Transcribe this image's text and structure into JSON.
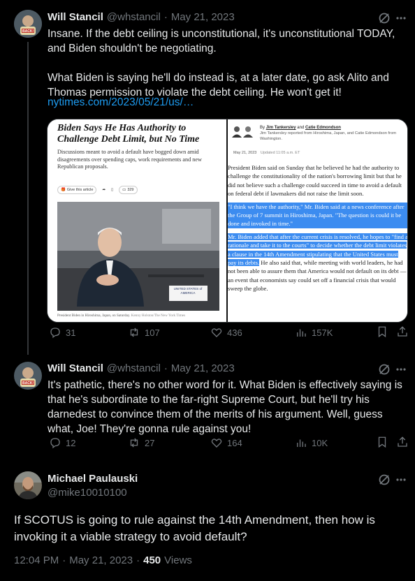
{
  "tweet1": {
    "name": "Will Stancil",
    "handle": "@whstancil",
    "dot": "·",
    "date": "May 21, 2023",
    "text": "Insane. If the debt ceiling is unconstitutional, it's unconstitutional TODAY, and Biden shouldn't be negotiating.\n\nWhat Biden is saying he'll do instead is, at a later date, go ask Alito and Thomas permission to violate the debt ceiling. He won't get it!",
    "link": "nytimes.com/2023/05/21/us/…",
    "media": {
      "headline": "Biden Says He Has Authority to Challenge Debt Limit, but No Time",
      "dek": "Discussions meant to avoid a default have bogged down amid disagreements over spending caps, work requirements and new Republican proposals.",
      "share_label": "Give this article",
      "comments_count": "329",
      "caption": "President Biden in Hiroshima, Japan, on Saturday.",
      "credit": "Kenny Holston/The New York Times",
      "placard": "UNITED STATES of AMERICA",
      "byline_prefix": "By",
      "author1": "Jim Tankersley",
      "byline_and": "and",
      "author2": "Catie Edmondson",
      "reported": "Jim Tankersley reported from Hiroshima, Japan, and Catie Edmondson from Washington.",
      "dateline": "May 21, 2023",
      "updated": "Updated 11:05 a.m. ET",
      "p1": "President Biden said on Sunday that he believed he had the authority to challenge the constitutionality of the nation's borrowing limit but that he did not believe such a challenge could succeed in time to avoid a default on federal debt if lawmakers did not raise the limit soon.",
      "p2": "\"I think we have the authority,\" Mr. Biden said at a news conference after the Group of 7 summit in Hiroshima, Japan. \"The question is could it be done and invoked in time.\"",
      "p3_hl": "Mr. Biden added that after the current crisis is resolved, he hopes to \"find a rationale and take it to the courts\" to decide whether the debt limit violates a clause in the 14th Amendment stipulating that the United States must pay its debts.",
      "p3_rest": " He also said that, while meeting with world leaders, he had not been able to assure them that America would not default on its debt — an event that economists say could set off a financial crisis that would sweep the globe."
    },
    "replies": "31",
    "reposts": "107",
    "likes": "436",
    "views": "157K"
  },
  "tweet2": {
    "name": "Will Stancil",
    "handle": "@whstancil",
    "dot": "·",
    "date": "May 21, 2023",
    "text": "It's pathetic, there's no other word for it. What Biden is effectively saying is that he's subordinate to the far-right Supreme Court, but he'll try his darnedest to convince them of the merits of his argument. Well, guess what, Joe! They're gonna rule against you!",
    "replies": "12",
    "reposts": "27",
    "likes": "164",
    "views": "10K"
  },
  "tweet3": {
    "name": "Michael Paulauski",
    "handle": "@mike10010100",
    "text": "If SCOTUS is going to rule against the 14th Amendment, then how is invoking it a viable strategy to avoid default?",
    "time": "12:04 PM",
    "dot": "·",
    "date": "May 21, 2023",
    "dot2": "·",
    "views_count": "450",
    "views_label": "Views"
  },
  "avatar_badge": "BACK!",
  "icons": [
    "grok-icon",
    "more-icon",
    "reply-icon",
    "repost-icon",
    "like-icon",
    "views-icon",
    "bookmark-icon",
    "share-icon"
  ],
  "colors": {
    "background": "#000000",
    "text": "#e7e9ea",
    "muted": "#71767b",
    "link": "#1d9bf0",
    "highlight": "#3c8cf0"
  }
}
